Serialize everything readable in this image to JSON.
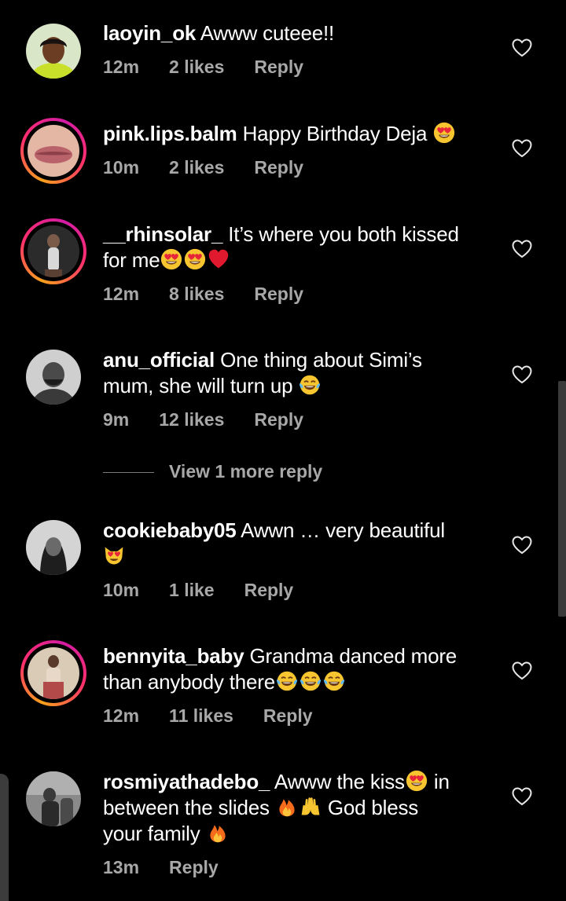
{
  "comments": [
    {
      "username": "laoyin_ok",
      "text": "Awww cuteee!!",
      "time": "12m",
      "likes": "2 likes",
      "reply": "Reply",
      "avatar_icon": "user-avatar-photo"
    },
    {
      "username": "pink.lips.balm",
      "text": "Happy Birthday Deja",
      "time": "10m",
      "likes": "2 likes",
      "reply": "Reply",
      "emojis": [
        "heart-eyes-emoji"
      ],
      "avatar_icon": "user-avatar-photo"
    },
    {
      "username": "__rhinsolar_",
      "text_line1": "It’s where you both kissed",
      "text_line2": "for me",
      "time": "12m",
      "likes": "8 likes",
      "reply": "Reply",
      "emojis": [
        "heart-eyes-emoji",
        "heart-eyes-emoji",
        "red-heart-emoji"
      ],
      "avatar_icon": "user-avatar-photo"
    },
    {
      "username": "anu_official",
      "text_line1": "One thing about Simi’s",
      "text_line2": "mum, she will turn up",
      "time": "9m",
      "likes": "12 likes",
      "reply": "Reply",
      "emojis": [
        "tears-of-joy-emoji"
      ],
      "avatar_icon": "user-avatar-photo"
    },
    {
      "username": "cookiebaby05",
      "text": "Awwn … very beautiful",
      "time": "10m",
      "likes": "1 like",
      "reply": "Reply",
      "emojis": [
        "heart-eyes-cat-emoji"
      ],
      "avatar_icon": "user-avatar-photo"
    },
    {
      "username": "bennyita_baby",
      "text_line1": "Grandma danced more",
      "text_line2": "than anybody there",
      "time": "12m",
      "likes": "11 likes",
      "reply": "Reply",
      "emojis": [
        "tears-of-joy-emoji",
        "tears-of-joy-emoji",
        "tears-of-joy-emoji"
      ],
      "avatar_icon": "user-avatar-photo"
    },
    {
      "username": "rosmiyathadebo_",
      "text_line1a": "Awww the kiss",
      "text_line1b": "in",
      "text_line2a": "between the slides",
      "text_line2b": "God bless",
      "text_line3": "your family",
      "time": "13m",
      "reply": "Reply",
      "emojis": [
        "heart-eyes-emoji",
        "fire-emoji",
        "raised-hands-emoji",
        "fire-emoji"
      ],
      "avatar_icon": "user-avatar-photo"
    }
  ],
  "view_more_replies": "View 1 more reply",
  "colors": {
    "background": "#000000",
    "primary_text": "#ffffff",
    "secondary_text": "#a8a8a8",
    "story_ring": "#ff2f6c"
  }
}
